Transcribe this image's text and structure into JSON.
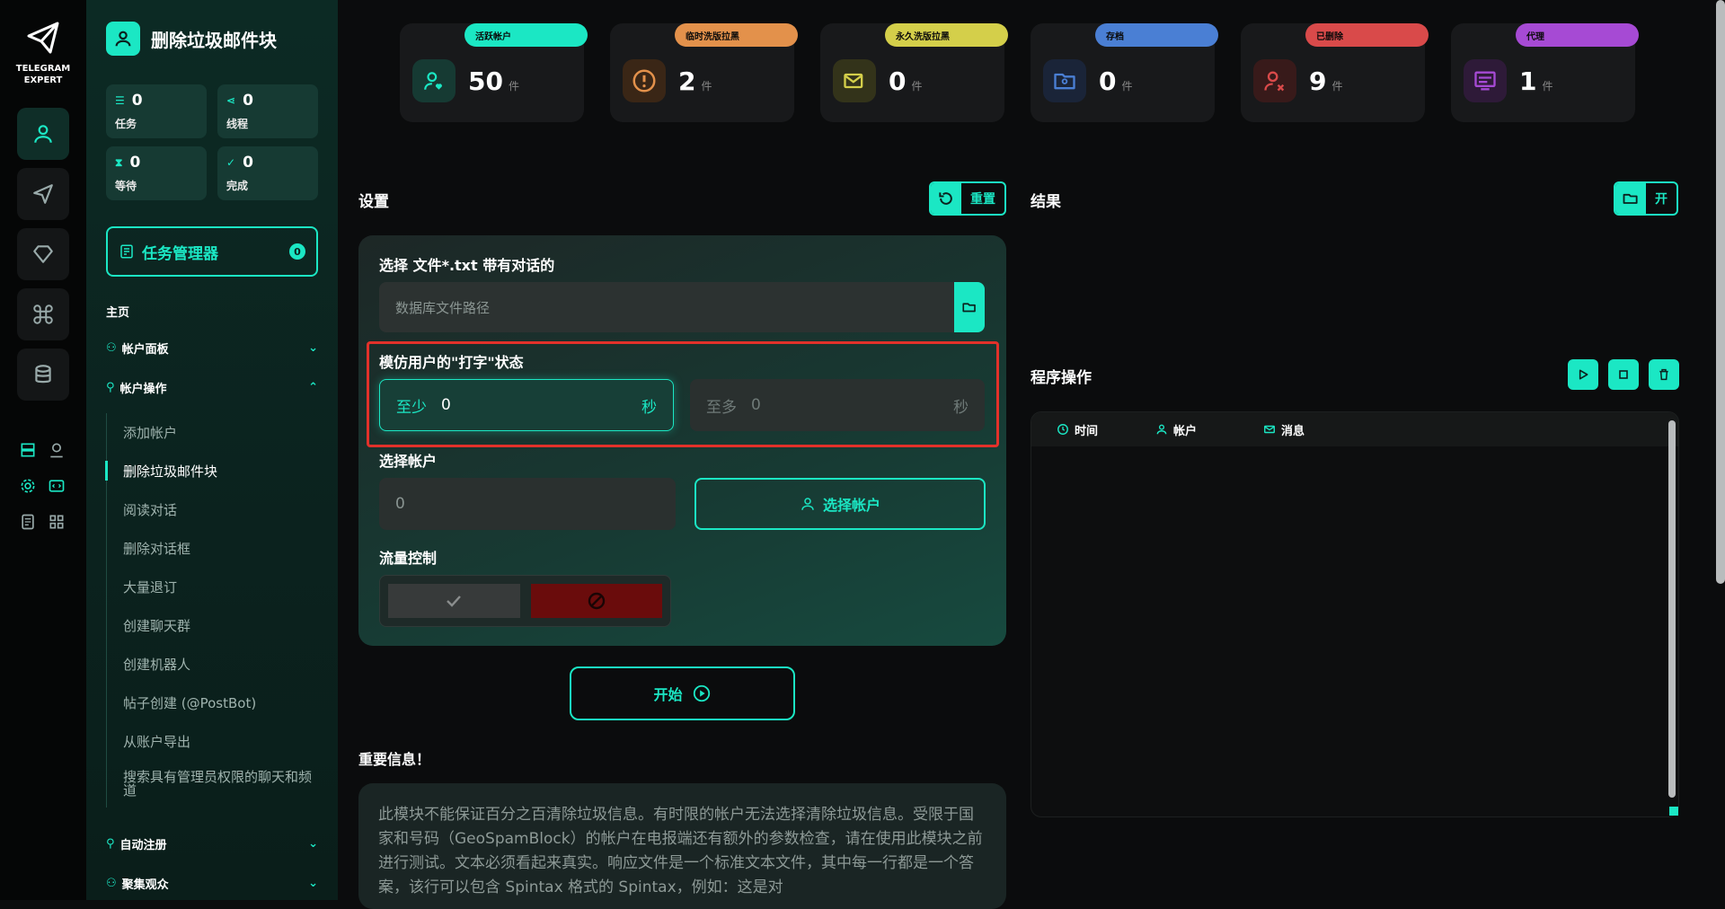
{
  "app": {
    "logo_line1": "TELEGRAM",
    "logo_line2": "EXPERT"
  },
  "sidebar": {
    "title": "删除垃圾邮件块",
    "stats": [
      {
        "value": "0",
        "label": "任务"
      },
      {
        "value": "0",
        "label": "线程"
      },
      {
        "value": "0",
        "label": "等待"
      },
      {
        "value": "0",
        "label": "完成"
      }
    ],
    "task_manager": {
      "label": "任务管理器",
      "count": "0"
    },
    "section_home": "主页",
    "group_accounts_panel": "帐户面板",
    "group_account_ops": "帐户操作",
    "subitems": [
      "添加帐户",
      "删除垃圾邮件块",
      "阅读对话",
      "删除对话框",
      "大量退订",
      "创建聊天群",
      "创建机器人",
      "帖子创建 (@PostBot)",
      "从账户导出",
      "搜索具有管理员权限的聊天和频道"
    ],
    "group_auto_register": "自动注册",
    "group_audience": "聚集观众"
  },
  "cards": [
    {
      "label": "活跃帐户",
      "value": "50",
      "unit": "件",
      "color": "#1be7c4"
    },
    {
      "label": "临时洗版拉黑",
      "value": "2",
      "unit": "件",
      "color": "#e3914b"
    },
    {
      "label": "永久洗版拉黑",
      "value": "0",
      "unit": "件",
      "color": "#d4cf4a"
    },
    {
      "label": "存档",
      "value": "0",
      "unit": "件",
      "color": "#4a7fd4"
    },
    {
      "label": "已删除",
      "value": "9",
      "unit": "件",
      "color": "#d94a4a"
    },
    {
      "label": "代理",
      "value": "1",
      "unit": "件",
      "color": "#a64ad4"
    }
  ],
  "settings": {
    "title": "设置",
    "reset_label": "重置",
    "file_label": "选择 文件*.txt 带有对话的",
    "file_placeholder": "数据库文件路径",
    "typing_label": "模仿用户的\"打字\"状态",
    "min_label": "至少",
    "min_value": "0",
    "max_label": "至多",
    "max_value": "0",
    "sec_unit": "秒",
    "account_label": "选择帐户",
    "account_value": "0",
    "account_button": "选择帐户",
    "flow_label": "流量控制",
    "start_label": "开始",
    "important_title": "重要信息！",
    "important_text": "此模块不能保证百分之百清除垃圾信息。有时限的帐户无法选择清除垃圾信息。受限于国家和号码（GeoSpamBlock）的帐户在电报端还有额外的参数检查，请在使用此模块之前进行测试。文本必须看起来真实。响应文件是一个标准文本文件，其中每一行都是一个答案，该行可以包含 Spintax 格式的 Spintax，例如：这是对"
  },
  "results": {
    "title": "结果",
    "open_label": "开",
    "ops_title": "程序操作",
    "col_time": "时间",
    "col_account": "帐户",
    "col_message": "消息"
  }
}
